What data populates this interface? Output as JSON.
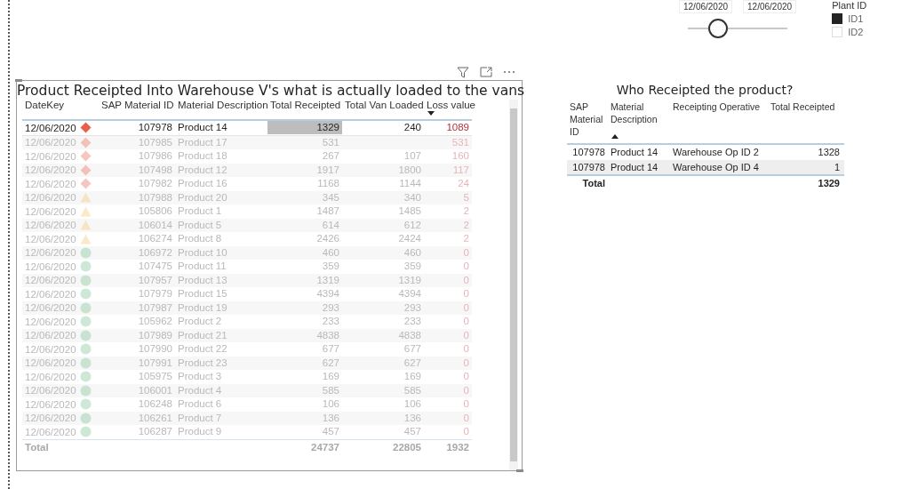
{
  "slicer": {
    "start_date": "12/06/2020",
    "end_date": "12/06/2020",
    "level": 0.3
  },
  "plant_filter": {
    "title": "Plant ID",
    "items": [
      {
        "label": "ID1",
        "checked": true
      },
      {
        "label": "ID2",
        "checked": false
      }
    ]
  },
  "loss_table": {
    "title": "Product Receipted Into Warehouse V's what is actually loaded to the vans",
    "columns": [
      {
        "label": "DateKey",
        "sort_descending": false
      },
      {
        "label": "SAP Material ID",
        "sort_descending": false
      },
      {
        "label": "Material Description",
        "sort_descending": false
      },
      {
        "label": "Total Receipted",
        "sort_descending": false
      },
      {
        "label": "Total Van Loaded",
        "sort_descending": false
      },
      {
        "label": "Loss value",
        "sort_descending": true
      }
    ],
    "rows": [
      {
        "date": "12/06/2020",
        "kind": "diamond",
        "material_id": "107978",
        "description": "Product 14",
        "receipted": "1329",
        "van_loaded": "240",
        "loss": "1089",
        "selected": true,
        "cell_highlighted": true
      },
      {
        "date": "12/06/2020",
        "kind": "diamond",
        "material_id": "107985",
        "description": "Product 17",
        "receipted": "531",
        "loss": "531",
        "selected": false,
        "cell_highlighted": false
      },
      {
        "date": "12/06/2020",
        "kind": "diamond",
        "material_id": "107986",
        "description": "Product 18",
        "receipted": "267",
        "van_loaded": "107",
        "loss": "160",
        "selected": false,
        "cell_highlighted": false
      },
      {
        "date": "12/06/2020",
        "kind": "diamond",
        "material_id": "107498",
        "description": "Product 12",
        "receipted": "1917",
        "van_loaded": "1800",
        "loss": "117",
        "selected": false,
        "cell_highlighted": false
      },
      {
        "date": "12/06/2020",
        "kind": "diamond",
        "material_id": "107982",
        "description": "Product 16",
        "receipted": "1168",
        "van_loaded": "1144",
        "loss": "24",
        "selected": false,
        "cell_highlighted": false
      },
      {
        "date": "12/06/2020",
        "kind": "triangle",
        "material_id": "107988",
        "description": "Product 20",
        "receipted": "345",
        "van_loaded": "340",
        "loss": "5",
        "selected": false,
        "cell_highlighted": false
      },
      {
        "date": "12/06/2020",
        "kind": "triangle",
        "material_id": "105806",
        "description": "Product 1",
        "receipted": "1487",
        "van_loaded": "1485",
        "loss": "2",
        "selected": false,
        "cell_highlighted": false
      },
      {
        "date": "12/06/2020",
        "kind": "triangle",
        "material_id": "106014",
        "description": "Product 5",
        "receipted": "614",
        "van_loaded": "612",
        "loss": "2",
        "selected": false,
        "cell_highlighted": false
      },
      {
        "date": "12/06/2020",
        "kind": "triangle",
        "material_id": "106274",
        "description": "Product 8",
        "receipted": "2426",
        "van_loaded": "2424",
        "loss": "2",
        "selected": false,
        "cell_highlighted": false
      },
      {
        "date": "12/06/2020",
        "kind": "circle",
        "material_id": "106972",
        "description": "Product 10",
        "receipted": "460",
        "van_loaded": "460",
        "loss": "0",
        "selected": false,
        "cell_highlighted": false
      },
      {
        "date": "12/06/2020",
        "kind": "circle",
        "material_id": "107475",
        "description": "Product 11",
        "receipted": "359",
        "van_loaded": "359",
        "loss": "0",
        "selected": false,
        "cell_highlighted": false
      },
      {
        "date": "12/06/2020",
        "kind": "circle",
        "material_id": "107957",
        "description": "Product 13",
        "receipted": "1319",
        "van_loaded": "1319",
        "loss": "0",
        "selected": false,
        "cell_highlighted": false
      },
      {
        "date": "12/06/2020",
        "kind": "circle",
        "material_id": "107979",
        "description": "Product 15",
        "receipted": "4394",
        "van_loaded": "4394",
        "loss": "0",
        "selected": false,
        "cell_highlighted": false
      },
      {
        "date": "12/06/2020",
        "kind": "circle",
        "material_id": "107987",
        "description": "Product 19",
        "receipted": "293",
        "van_loaded": "293",
        "loss": "0",
        "selected": false,
        "cell_highlighted": false
      },
      {
        "date": "12/06/2020",
        "kind": "circle",
        "material_id": "105962",
        "description": "Product 2",
        "receipted": "233",
        "van_loaded": "233",
        "loss": "0",
        "selected": false,
        "cell_highlighted": false
      },
      {
        "date": "12/06/2020",
        "kind": "circle",
        "material_id": "107989",
        "description": "Product 21",
        "receipted": "4838",
        "van_loaded": "4838",
        "loss": "0",
        "selected": false,
        "cell_highlighted": false
      },
      {
        "date": "12/06/2020",
        "kind": "circle",
        "material_id": "107990",
        "description": "Product 22",
        "receipted": "677",
        "van_loaded": "677",
        "loss": "0",
        "selected": false,
        "cell_highlighted": false
      },
      {
        "date": "12/06/2020",
        "kind": "circle",
        "material_id": "107991",
        "description": "Product 23",
        "receipted": "627",
        "van_loaded": "627",
        "loss": "0",
        "selected": false,
        "cell_highlighted": false
      },
      {
        "date": "12/06/2020",
        "kind": "circle",
        "material_id": "105975",
        "description": "Product 3",
        "receipted": "169",
        "van_loaded": "169",
        "loss": "0",
        "selected": false,
        "cell_highlighted": false
      },
      {
        "date": "12/06/2020",
        "kind": "circle",
        "material_id": "106001",
        "description": "Product 4",
        "receipted": "585",
        "van_loaded": "585",
        "loss": "0",
        "selected": false,
        "cell_highlighted": false
      },
      {
        "date": "12/06/2020",
        "kind": "circle",
        "material_id": "106248",
        "description": "Product 6",
        "receipted": "106",
        "van_loaded": "106",
        "loss": "0",
        "selected": false,
        "cell_highlighted": false
      },
      {
        "date": "12/06/2020",
        "kind": "circle",
        "material_id": "106261",
        "description": "Product 7",
        "receipted": "136",
        "van_loaded": "136",
        "loss": "0",
        "selected": false,
        "cell_highlighted": false
      },
      {
        "date": "12/06/2020",
        "kind": "circle",
        "material_id": "106287",
        "description": "Product 9",
        "receipted": "457",
        "van_loaded": "457",
        "loss": "0",
        "selected": false,
        "cell_highlighted": false
      }
    ],
    "total": {
      "label": "Total",
      "receipted": "24737",
      "van_loaded": "22805",
      "loss": "1932"
    }
  },
  "operator_table": {
    "title": "Who Receipted the product?",
    "columns": [
      {
        "label": "SAP Material ID",
        "sort_ascending": false
      },
      {
        "label": "Material Description",
        "sort_ascending": true
      },
      {
        "label": "Receipting Operative",
        "sort_ascending": false
      },
      {
        "label": "Total Receipted",
        "sort_ascending": false
      }
    ],
    "rows": [
      {
        "material_id": "107978",
        "description": "Product 14",
        "operative": "Warehouse Op ID 2",
        "receipted": "1328"
      },
      {
        "material_id": "107978",
        "description": "Product 14",
        "operative": "Warehouse Op ID 4",
        "receipted": "1"
      }
    ],
    "total": {
      "label": "Total",
      "receipted": "1329"
    }
  }
}
